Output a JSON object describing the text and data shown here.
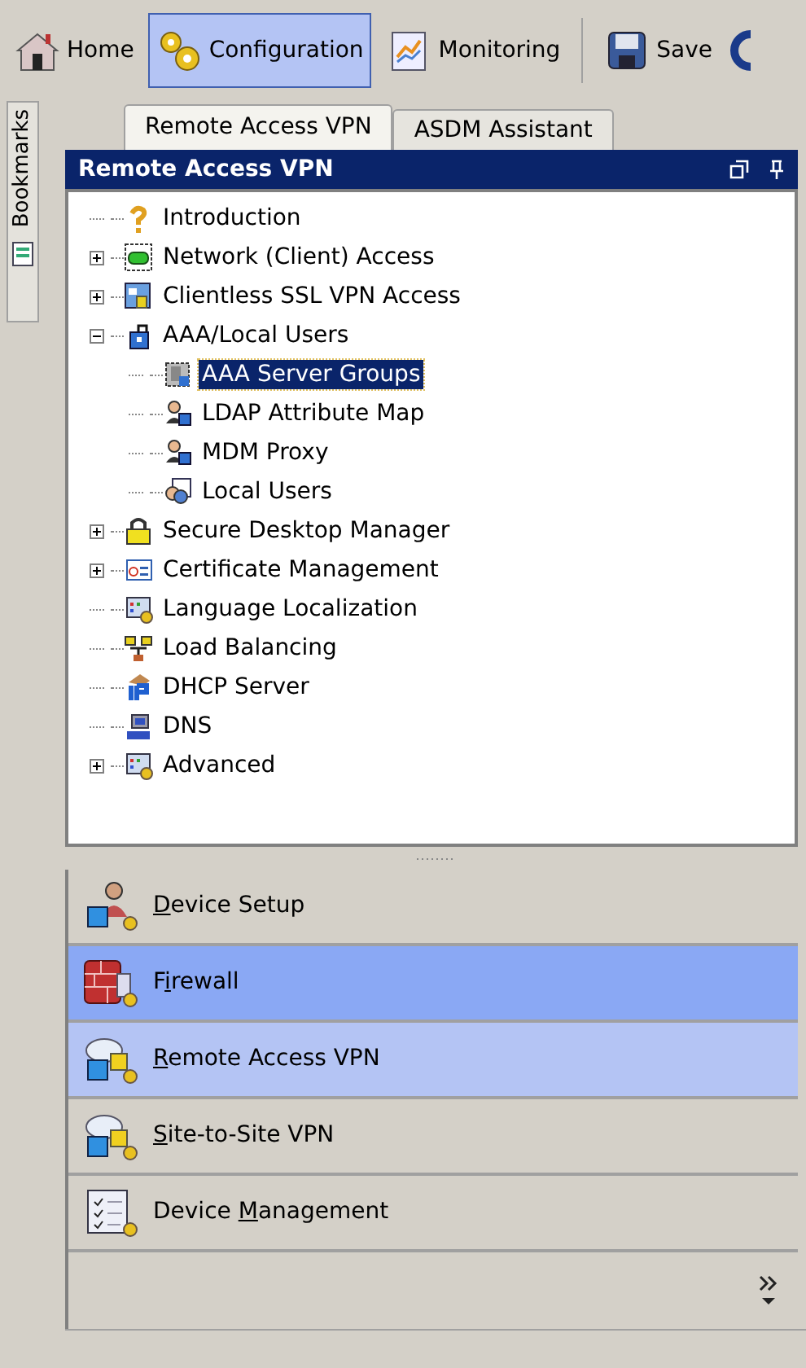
{
  "toolbar": [
    {
      "label": "Home",
      "kind": "home",
      "selected": false
    },
    {
      "label": "Configuration",
      "kind": "gears",
      "selected": true
    },
    {
      "label": "Monitoring",
      "kind": "chart",
      "selected": false
    },
    {
      "label": "Save",
      "kind": "disk",
      "selected": false
    }
  ],
  "bookmarks_tab": {
    "label": "Bookmarks"
  },
  "tabs": [
    {
      "label": "Remote Access VPN",
      "selected": true
    },
    {
      "label": "ASDM Assistant",
      "selected": false
    }
  ],
  "panel": {
    "title": "Remote Access VPN"
  },
  "tree": [
    {
      "label": "Introduction",
      "kind": "help",
      "selected": false
    },
    {
      "label": "Network (Client) Access",
      "kind": "plug",
      "expanded": false,
      "selected": false
    },
    {
      "label": "Clientless SSL VPN Access",
      "kind": "window",
      "expanded": false,
      "selected": false
    },
    {
      "label": "AAA/Local Users",
      "kind": "lock",
      "expanded": true,
      "selected": false,
      "children": [
        {
          "label": "AAA Server Groups",
          "kind": "server",
          "selected": true
        },
        {
          "label": "LDAP Attribute Map",
          "kind": "user",
          "selected": false
        },
        {
          "label": "MDM Proxy",
          "kind": "user",
          "selected": false
        },
        {
          "label": "Local Users",
          "kind": "users",
          "selected": false
        }
      ]
    },
    {
      "label": "Secure Desktop Manager",
      "kind": "padlock",
      "expanded": false,
      "selected": false
    },
    {
      "label": "Certificate Management",
      "kind": "certificate",
      "expanded": false,
      "selected": false
    },
    {
      "label": "Language Localization",
      "kind": "app",
      "selected": false
    },
    {
      "label": "Load Balancing",
      "kind": "network",
      "selected": false
    },
    {
      "label": "DHCP Server",
      "kind": "ip",
      "selected": false
    },
    {
      "label": "DNS",
      "kind": "dns",
      "selected": false
    },
    {
      "label": "Advanced",
      "kind": "app",
      "expanded": false,
      "selected": false
    }
  ],
  "nav": [
    {
      "access_key": "D",
      "label_end": "evice Setup",
      "kind": "person",
      "selected": false,
      "hovered": false
    },
    {
      "label_start": "F",
      "access_key": "i",
      "label_end": "rewall",
      "kind": "wall",
      "selected": false,
      "hovered": true
    },
    {
      "access_key": "R",
      "label_end": "emote Access VPN",
      "kind": "vpn",
      "selected": true,
      "hovered": false
    },
    {
      "access_key": "S",
      "label_end": "ite-to-Site VPN",
      "kind": "vpn",
      "selected": false,
      "hovered": false
    },
    {
      "label_start": "Device ",
      "access_key": "M",
      "label_end": "anagement",
      "kind": "checklist",
      "selected": false,
      "hovered": false
    }
  ]
}
